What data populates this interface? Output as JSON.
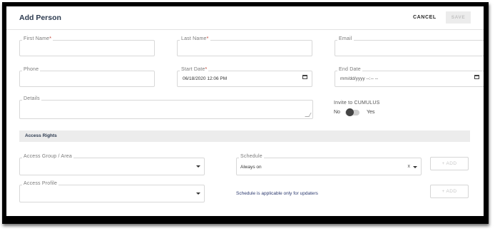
{
  "header": {
    "title": "Add Person",
    "cancel_label": "CANCEL",
    "save_label": "SAVE"
  },
  "fields": {
    "first_name": {
      "label": "First Name",
      "required": "*"
    },
    "last_name": {
      "label": "Last Name",
      "required": "*"
    },
    "email": {
      "label": "Email"
    },
    "phone": {
      "label": "Phone"
    },
    "start_date": {
      "label": "Start Date",
      "required": "*",
      "value": "06/18/2020 12:06 PM"
    },
    "end_date": {
      "label": "End Date",
      "value": "mm/dd/yyyy --:-- --"
    },
    "details": {
      "label": "Details"
    }
  },
  "invite": {
    "label": "Invite to CUMULUS",
    "off_label": "No",
    "on_label": "Yes",
    "enabled": false
  },
  "access_rights": {
    "section_label": "Access Rights",
    "group_area": {
      "label": "Access Group / Area"
    },
    "schedule": {
      "label": "Schedule",
      "value": "Always on",
      "clear": "x"
    },
    "profile": {
      "label": "Access Profile"
    },
    "add_label": "+ ADD",
    "note": "Schedule is applicable only for updaters"
  },
  "icons": [
    "calendar-icon",
    "caret-down-icon",
    "clear-icon",
    "resize-handle-icon"
  ]
}
